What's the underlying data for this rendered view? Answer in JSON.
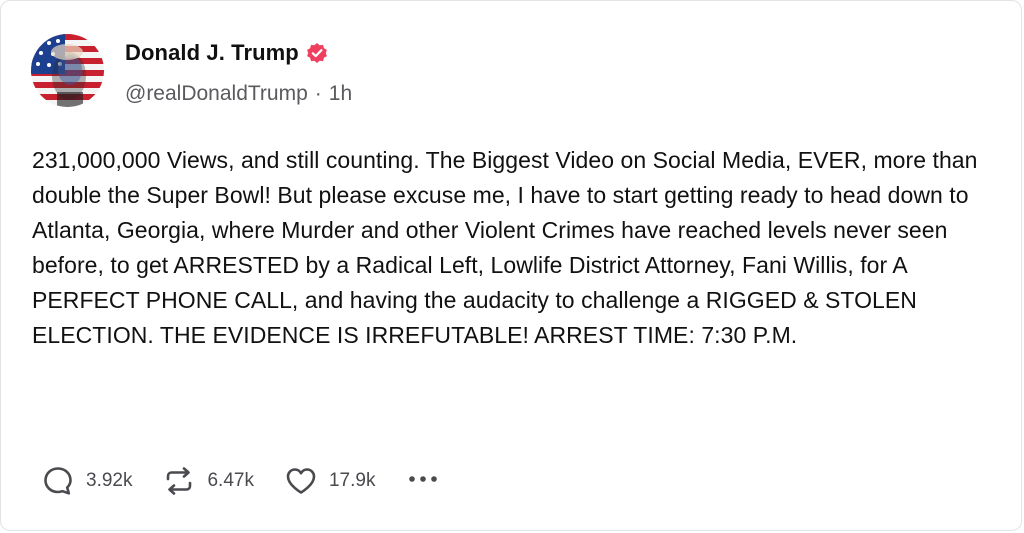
{
  "post": {
    "author": {
      "display_name": "Donald J. Trump",
      "handle": "@realDonaldTrump",
      "separator": "·",
      "time_ago": "1h",
      "verified": true,
      "verified_color": "#f03e5e"
    },
    "text": "231,000,000 Views, and still counting. The Biggest Video on Social Media, EVER, more than double the Super Bowl! But please excuse me, I have to start getting ready to head down to Atlanta, Georgia, where Murder and other Violent Crimes have reached levels never seen before, to get ARRESTED by a Radical Left, Lowlife District Attorney, Fani Willis, for A PERFECT PHONE CALL, and having the audacity to challenge a RIGGED & STOLEN ELECTION. THE EVIDENCE IS IRREFUTABLE! ARREST TIME: 7:30 P.M.",
    "actions": {
      "replies": {
        "icon": "comment-icon",
        "count": "3.92k"
      },
      "reposts": {
        "icon": "repost-icon",
        "count": "6.47k"
      },
      "likes": {
        "icon": "heart-icon",
        "count": "17.9k"
      },
      "more": {
        "icon": "more-icon"
      }
    }
  },
  "colors": {
    "text": "#111111",
    "muted": "#5a5a5f",
    "icon": "#4a4a4f",
    "border": "#e3e3e6"
  }
}
